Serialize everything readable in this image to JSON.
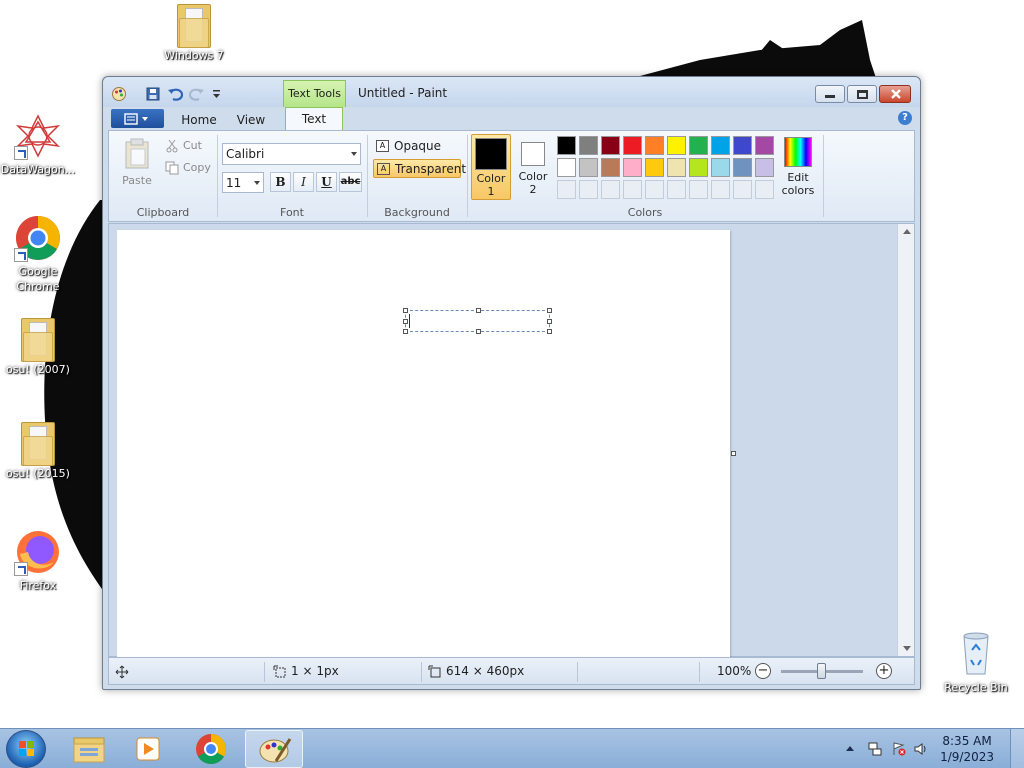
{
  "desktop": {
    "icons": [
      {
        "label": "Windows 7",
        "icon": "folder-icon"
      },
      {
        "label": "DataWagon...",
        "icon": "datawagon-icon"
      },
      {
        "label": "Google Chrome",
        "icon": "chrome-icon"
      },
      {
        "label": "osu! (2007)",
        "icon": "folder-icon"
      },
      {
        "label": "osu! (2015)",
        "icon": "folder-icon"
      },
      {
        "label": "Firefox",
        "icon": "firefox-icon"
      },
      {
        "label": "Recycle Bin",
        "icon": "recycle-bin-icon"
      }
    ]
  },
  "window": {
    "title": "Untitled - Paint",
    "contextual_tab": "Text Tools",
    "tabs": [
      "Home",
      "View",
      "Text"
    ],
    "active_tab": "Text"
  },
  "ribbon": {
    "clipboard": {
      "paste": "Paste",
      "cut": "Cut",
      "copy": "Copy",
      "label": "Clipboard"
    },
    "font": {
      "family": "Calibri",
      "size": "11",
      "bold": "B",
      "italic": "I",
      "underline": "U",
      "strike": "abc",
      "label": "Font"
    },
    "background": {
      "opaque": "Opaque",
      "transparent": "Transparent",
      "selected": "Transparent",
      "label": "Background"
    },
    "colors": {
      "color1": "Color\n1",
      "color1_l1": "Color",
      "color1_l2": "1",
      "color2_l1": "Color",
      "color2_l2": "2",
      "color1_value": "#000000",
      "color2_value": "#ffffff",
      "palette_row1": [
        "#000000",
        "#7f7f7f",
        "#880015",
        "#ed1c24",
        "#ff7f27",
        "#fff200",
        "#22b14c",
        "#00a2e8",
        "#3f48cc",
        "#a349a4"
      ],
      "palette_row2": [
        "#ffffff",
        "#c3c3c3",
        "#b97a57",
        "#ffaec9",
        "#ffc90e",
        "#efe4b0",
        "#b5e61d",
        "#99d9ea",
        "#7092be",
        "#c8bfe7"
      ],
      "edit_l1": "Edit",
      "edit_l2": "colors",
      "label": "Colors"
    }
  },
  "status": {
    "cursor_pos": "",
    "selection_size": "1 × 1px",
    "canvas_size": "614 × 460px",
    "zoom": "100%"
  },
  "taskbar": {
    "time": "8:35 AM",
    "date": "1/9/2023"
  }
}
